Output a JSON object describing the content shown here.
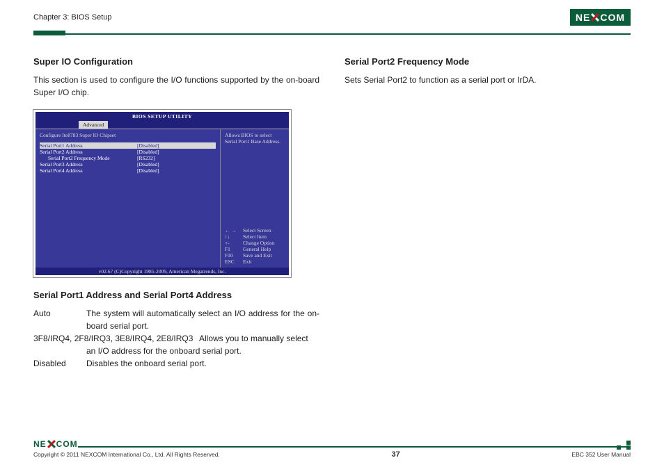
{
  "header": {
    "chapter": "Chapter 3: BIOS Setup",
    "logo_pre": "NE",
    "logo_post": "COM"
  },
  "left": {
    "h1": "Super IO Configuration",
    "intro": "This section is used to configure the I/O functions supported by the on-board Super I/O chip.",
    "h2": "Serial Port1 Address and Serial Port4 Address",
    "opts": {
      "auto_key": "Auto",
      "auto_desc": "The system will automatically select an I/O address for the on-board serial port.",
      "manual_key": "3F8/IRQ4, 2F8/IRQ3, 3E8/IRQ4, 2E8/IRQ3",
      "manual_desc": "Allows you to manually select an I/O address for the onboard serial port.",
      "disabled_key": "Disabled",
      "disabled_desc": "Disables the onboard serial port."
    }
  },
  "right": {
    "h1": "Serial Port2 Frequency Mode",
    "intro": "Sets Serial Port2 to function as a serial port or IrDA."
  },
  "bios": {
    "title": "BIOS SETUP UTILITY",
    "tab": "Advanced",
    "heading": "Configure Ite8783 Super IO Chipset",
    "rows": [
      {
        "label": "Serial Port1 Address",
        "value": "[Disabled]",
        "selected": true
      },
      {
        "label": "Serial Port2 Address",
        "value": "[Disabled]"
      },
      {
        "label": "Serial Port2 Frequency Mode",
        "value": "[RS232]",
        "indent": true
      },
      {
        "label": "Serial Port3 Address",
        "value": "[Disabled]"
      },
      {
        "label": "Serial Port4 Address",
        "value": "[Disabled]"
      }
    ],
    "help": "Allows BIOS to select Serial Port1 Base Address.",
    "keys": [
      {
        "k": "← →",
        "d": "Select Screen"
      },
      {
        "k": "↑↓",
        "d": "Select Item"
      },
      {
        "k": "+-",
        "d": "Change Option"
      },
      {
        "k": "F1",
        "d": "General Help"
      },
      {
        "k": "F10",
        "d": "Save and Exit"
      },
      {
        "k": "ESC",
        "d": "Exit"
      }
    ],
    "footer": "v02.67 (C)Copyright 1985-2009, American Megatrends, Inc."
  },
  "footer": {
    "copyright": "Copyright © 2011 NEXCOM International Co., Ltd. All Rights Reserved.",
    "page": "37",
    "doc": "EBC 352 User Manual"
  }
}
